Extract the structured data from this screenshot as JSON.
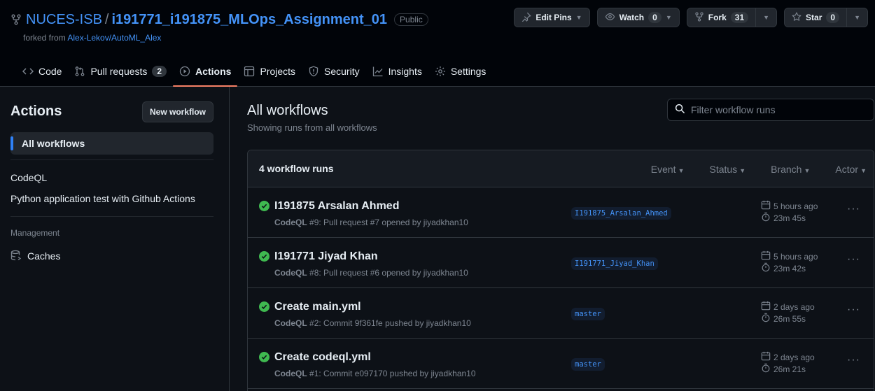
{
  "header": {
    "owner": "NUCES-ISB",
    "separator": "/",
    "repo": "i191771_i191875_MLOps_Assignment_01",
    "visibility": "Public",
    "forked_prefix": "forked from ",
    "forked_source": "Alex-Lekov/AutoML_Alex",
    "buttons": {
      "edit_pins": "Edit Pins",
      "watch": "Watch",
      "watch_count": "0",
      "fork": "Fork",
      "fork_count": "31",
      "star": "Star",
      "star_count": "0"
    }
  },
  "nav": {
    "tabs": [
      {
        "label": "Code"
      },
      {
        "label": "Pull requests",
        "count": "2"
      },
      {
        "label": "Actions"
      },
      {
        "label": "Projects"
      },
      {
        "label": "Security"
      },
      {
        "label": "Insights"
      },
      {
        "label": "Settings"
      }
    ],
    "active": "Actions"
  },
  "sidebar": {
    "title": "Actions",
    "new_workflow": "New workflow",
    "all_workflows": "All workflows",
    "workflows": [
      "CodeQL",
      "Python application test with Github Actions"
    ],
    "management_heading": "Management",
    "caches": "Caches"
  },
  "main": {
    "title": "All workflows",
    "subtitle": "Showing runs from all workflows",
    "filter_placeholder": "Filter workflow runs",
    "runs_count_label": "4 workflow runs",
    "filters": [
      "Event",
      "Status",
      "Branch",
      "Actor"
    ],
    "runs": [
      {
        "title": "I191875 Arsalan Ahmed",
        "workflow": "CodeQL",
        "meta": "#9: Pull request #7 opened by jiyadkhan10",
        "branch": "I191875_Arsalan_Ahmed",
        "time": "5 hours ago",
        "duration": "23m 45s",
        "status": "success"
      },
      {
        "title": "I191771 Jiyad Khan",
        "workflow": "CodeQL",
        "meta": "#8: Pull request #6 opened by jiyadkhan10",
        "branch": "I191771_Jiyad_Khan",
        "time": "5 hours ago",
        "duration": "23m 42s",
        "status": "success"
      },
      {
        "title": "Create main.yml",
        "workflow": "CodeQL",
        "meta": "#2: Commit 9f361fe pushed by jiyadkhan10",
        "branch": "master",
        "time": "2 days ago",
        "duration": "26m 55s",
        "status": "success"
      },
      {
        "title": "Create codeql.yml",
        "workflow": "CodeQL",
        "meta": "#1: Commit e097170 pushed by jiyadkhan10",
        "branch": "master",
        "time": "2 days ago",
        "duration": "26m 21s",
        "status": "success"
      }
    ]
  },
  "colors": {
    "background": "#0d1117",
    "header_bg": "#010409",
    "link": "#4493f8",
    "success": "#3fb950",
    "active_tab_underline": "#f78166"
  }
}
